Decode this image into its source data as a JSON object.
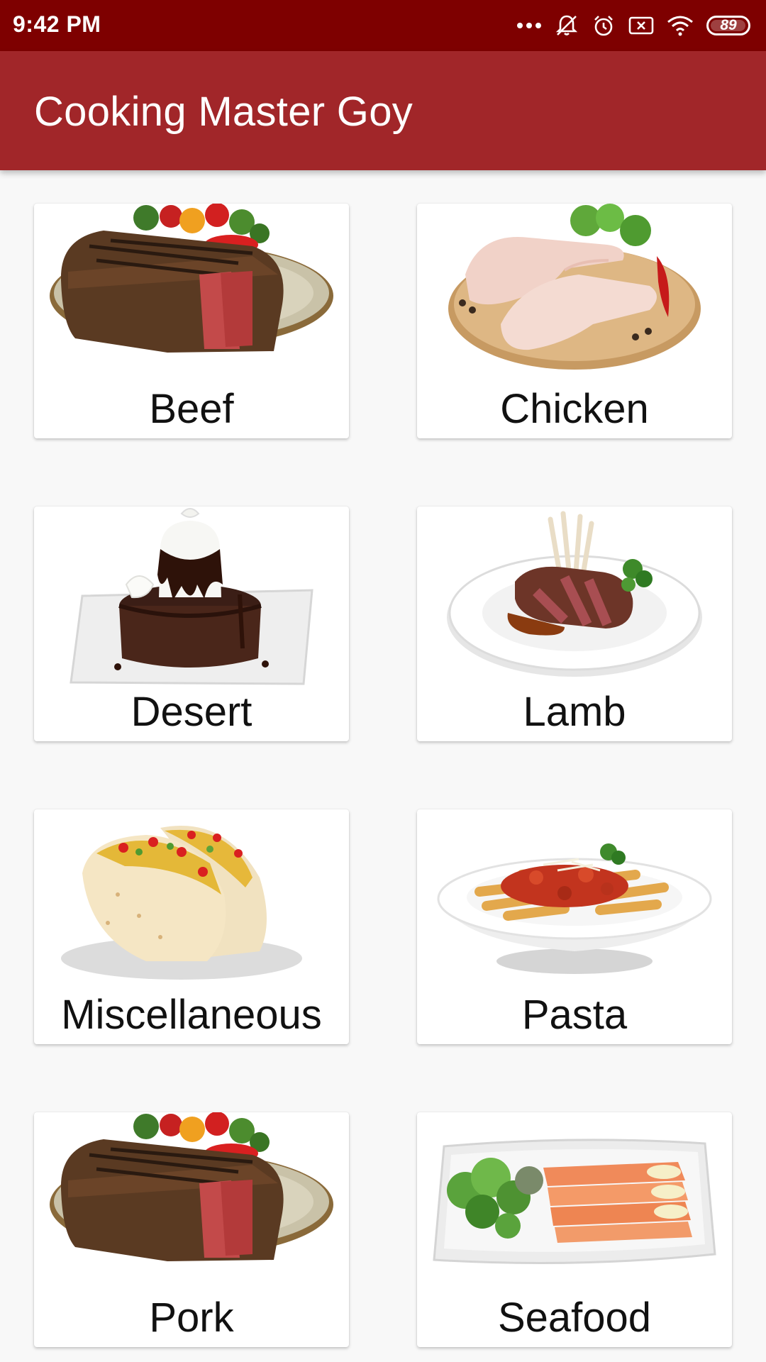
{
  "status_bar": {
    "time": "9:42 PM",
    "battery": "89",
    "icons": [
      "more-dots-icon",
      "bell-muted-icon",
      "alarm-icon",
      "sim-error-icon",
      "wifi-icon",
      "battery-icon"
    ]
  },
  "app_bar": {
    "title": "Cooking Master Goy"
  },
  "colors": {
    "status_bar": "#7e0000",
    "app_bar": "#a12629",
    "background": "#f8f8f8",
    "card": "#ffffff"
  },
  "categories": [
    {
      "label": "Beef",
      "image": "steak-plate-image"
    },
    {
      "label": "Chicken",
      "image": "raw-chicken-board-image"
    },
    {
      "label": "Desert",
      "image": "chocolate-cake-image"
    },
    {
      "label": "Lamb",
      "image": "lamb-chops-plate-image"
    },
    {
      "label": "Miscellaneous",
      "image": "tacos-image"
    },
    {
      "label": "Pasta",
      "image": "penne-pasta-bowl-image"
    },
    {
      "label": "Pork",
      "image": "steak-plate-image"
    },
    {
      "label": "Seafood",
      "image": "salmon-salad-plate-image"
    }
  ]
}
